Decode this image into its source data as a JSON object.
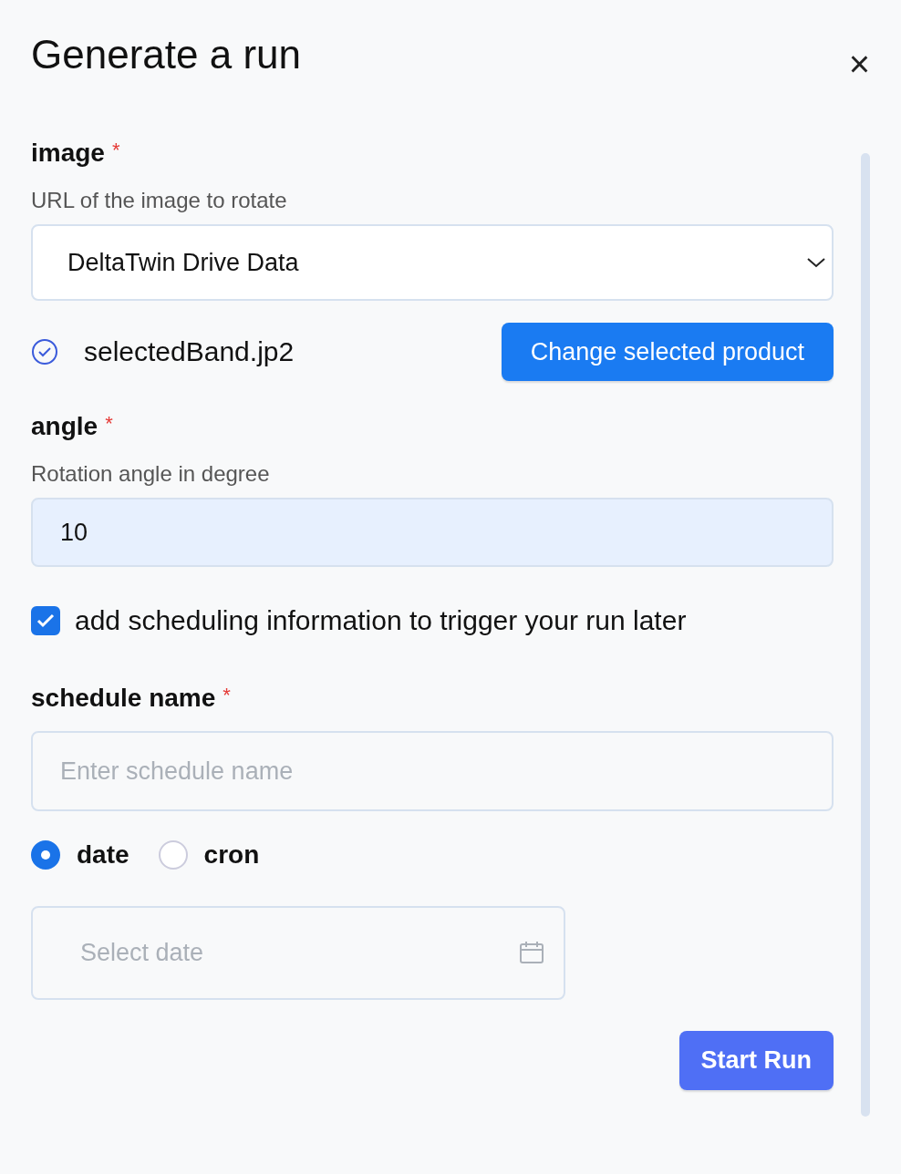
{
  "dialog": {
    "title": "Generate a run",
    "close": "×"
  },
  "image_field": {
    "label": "image",
    "required_mark": "*",
    "description": "URL of the image to rotate",
    "value": "DeltaTwin Drive Data",
    "selected_file": "selectedBand.jp2",
    "button": "Change selected product"
  },
  "angle_field": {
    "label": "angle",
    "required_mark": "*",
    "description": "Rotation angle in degree",
    "value": "10"
  },
  "schedule_checkbox": {
    "label": "add scheduling information to trigger your run later",
    "checked": true
  },
  "schedule_name": {
    "label": "schedule name",
    "required_mark": "*",
    "placeholder": "Enter schedule name"
  },
  "schedule_type": [
    {
      "label": "date",
      "selected": true
    },
    {
      "label": "cron",
      "selected": false
    }
  ],
  "date_field": {
    "placeholder": "Select date"
  },
  "start_button": "Start Run"
}
